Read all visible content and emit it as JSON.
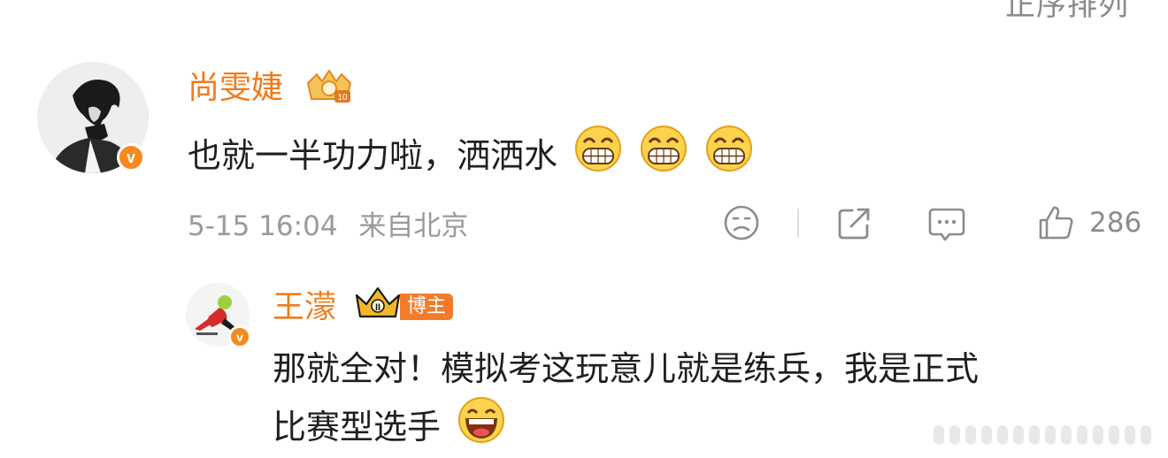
{
  "header": {
    "partial_text": "正序排列"
  },
  "comment": {
    "username": "尚雯婕",
    "text": "也就一半功力啦，洒洒水",
    "emojis": [
      "grin-icon",
      "grin-icon",
      "grin-icon"
    ],
    "time": "5-15 16:04",
    "location": "来自北京",
    "likes": "286",
    "badge_letter": "v",
    "crown_level": "10"
  },
  "reply": {
    "username": "王濛",
    "tag": "博主",
    "text_line1": "那就全对！模拟考这玩意儿就是练兵，我是正式",
    "text_line2": "比赛型选手",
    "emoji": "laugh-icon",
    "badge_letter": "v",
    "crown_level": "II"
  },
  "colors": {
    "username": "#f07b1d",
    "verified": "#f58a1f",
    "meta": "#9a9a9a",
    "tag_bg": "#f27b2a"
  }
}
